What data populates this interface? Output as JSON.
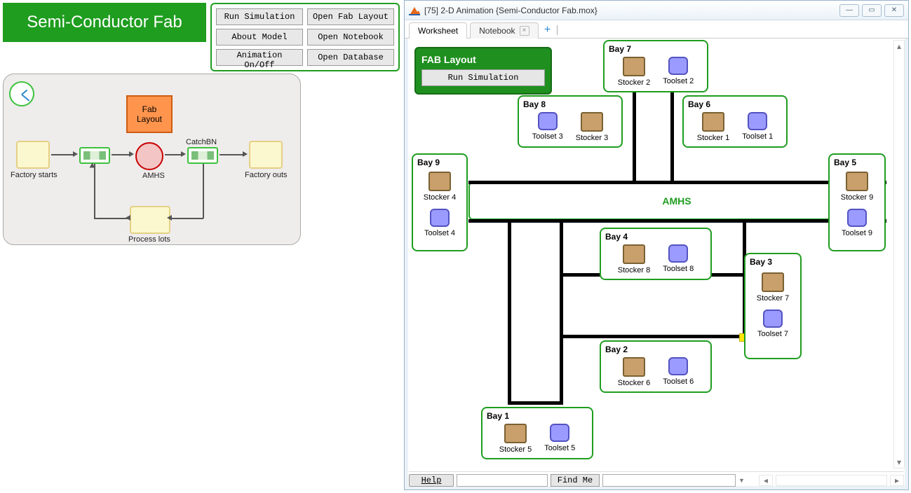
{
  "header": {
    "title": "Semi-Conductor Fab"
  },
  "button_panel": {
    "run_simulation": "Run Simulation",
    "open_fab_layout": "Open Fab Layout",
    "about_model": "About Model",
    "open_notebook": "Open Notebook",
    "animation_toggle": "Animation On/Off",
    "open_database": "Open Database"
  },
  "flow": {
    "fab_layout": "Fab\nLayout",
    "factory_starts": "Factory starts",
    "amhs": "AMHS",
    "catchbn": "CatchBN",
    "factory_outs": "Factory outs",
    "process_lots": "Process lots"
  },
  "anim_window": {
    "title": "[75] 2-D Animation {Semi-Conductor Fab.mox}",
    "tabs": {
      "worksheet": "Worksheet",
      "notebook": "Notebook"
    },
    "fab_badge": {
      "title": "FAB Layout",
      "run": "Run Simulation"
    },
    "amhs_label": "AMHS",
    "help": "Help",
    "find_placeholder": "",
    "find_btn": "Find Me"
  },
  "bays": {
    "b1": {
      "title": "Bay 1",
      "stocker": "Stocker 5",
      "toolset": "Toolset 5"
    },
    "b2": {
      "title": "Bay 2",
      "stocker": "Stocker 6",
      "toolset": "Toolset 6"
    },
    "b3": {
      "title": "Bay 3",
      "stocker": "Stocker 7",
      "toolset": "Toolset 7"
    },
    "b4": {
      "title": "Bay 4",
      "stocker": "Stocker 8",
      "toolset": "Toolset 8"
    },
    "b5": {
      "title": "Bay 5",
      "stocker": "Stocker 9",
      "toolset": "Toolset 9"
    },
    "b6": {
      "title": "Bay 6",
      "stocker": "Stocker 1",
      "toolset": "Toolset 1"
    },
    "b7": {
      "title": "Bay 7",
      "stocker": "Stocker 2",
      "toolset": "Toolset 2"
    },
    "b8": {
      "title": "Bay 8",
      "stocker": "Stocker 3",
      "toolset": "Toolset 3"
    },
    "b9": {
      "title": "Bay 9",
      "stocker": "Stocker 4",
      "toolset": "Toolset 4"
    }
  }
}
